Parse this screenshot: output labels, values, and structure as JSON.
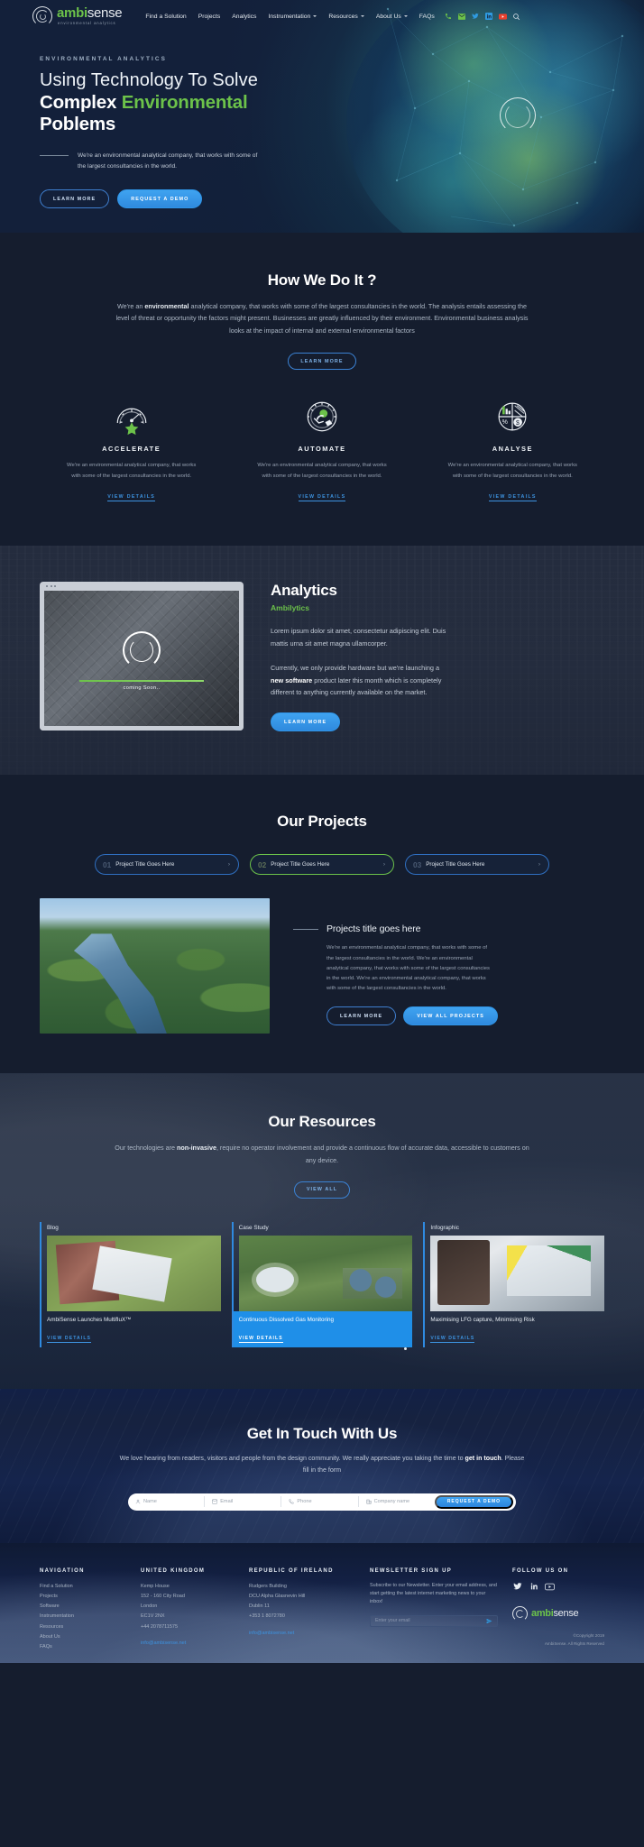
{
  "header": {
    "logo": {
      "brand_prefix": "ambi",
      "brand_suffix": "sense",
      "tagline": "environmental analytics"
    },
    "nav": [
      {
        "label": "Find a Solution",
        "has_caret": false
      },
      {
        "label": "Projects",
        "has_caret": false
      },
      {
        "label": "Analytics",
        "has_caret": false
      },
      {
        "label": "Instrumentation",
        "has_caret": true
      },
      {
        "label": "Resources",
        "has_caret": true
      },
      {
        "label": "About Us",
        "has_caret": true
      },
      {
        "label": "FAQs",
        "has_caret": false
      }
    ],
    "social": [
      "phone-icon",
      "email-icon",
      "twitter-icon",
      "linkedin-icon",
      "youtube-icon",
      "search-icon"
    ]
  },
  "hero": {
    "eyebrow": "ENVIRONMENTAL ANALYTICS",
    "title_line1": "Using Technology To Solve",
    "title_line2_white": "Complex",
    "title_line2_green": "Environmental",
    "title_line3": "Poblems",
    "description": "We're an environmental analytical company, that works with some of the largest consultancies in the world.",
    "btn_learn_more": "LEARN MORE",
    "btn_request_demo": "REQUEST A DEMO"
  },
  "how": {
    "title": "How We Do It ?",
    "intro_pre": "We're an ",
    "intro_bold": "environmental",
    "intro_post": " analytical company, that works with some of the largest consultancies in the world. The analysis entails assessing the level of threat or opportunity the factors might present. Businesses are greatly influenced by their environment. Environmental business analysis looks at the impact of internal and external environmental factors",
    "btn_learn_more": "LEARN MORE",
    "cards": [
      {
        "icon": "speedometer-star-icon",
        "title": "ACCELERATE",
        "text": "We're an environmental analytical company, that works with some of the largest consultancies in the world.",
        "link": "VIEW DETAILS"
      },
      {
        "icon": "gear-dial-icon",
        "title": "AUTOMATE",
        "text": "We're an environmental analytical company, that works with some of the largest consultancies in the world.",
        "link": "VIEW DETAILS"
      },
      {
        "icon": "pie-chart-icon",
        "title": "ANALYSE",
        "text": "We're an environmental analytical company, that works with some of the largest consultancies in the world.",
        "link": "VIEW DETAILS"
      }
    ]
  },
  "analytics": {
    "title": "Analytics",
    "subtitle": "Ambilytics",
    "paragraph1": "Lorem ipsum dolor sit amet, consectetur adipiscing elit. Duis mattis urna sit amet magna ullamcorper.",
    "p2_pre": "Currently, we only provide hardware but we're launching a ",
    "p2_bold": "new software",
    "p2_post": " product later this month which is completely different to anything currently available on the market.",
    "btn_learn_more": "LEARN MORE",
    "screen_caption": "coming Soon.."
  },
  "projects": {
    "title": "Our Projects",
    "tabs": [
      {
        "num": "01",
        "label": "Project Title Goes Here",
        "active": false
      },
      {
        "num": "02",
        "label": "Project Title Goes Here",
        "active": true
      },
      {
        "num": "03",
        "label": "Project Title Goes Here",
        "active": false
      }
    ],
    "detail_title": "Projects title goes here",
    "detail_text": "We're an environmental analytical company, that works with some of the largest consultancies in the world. We're an environmental analytical company, that works with some of the largest consultancies in the world. We're an environmental analytical company, that works with some of the largest consultancies in the world.",
    "btn_learn_more": "LEARN MORE",
    "btn_view_all": "VIEW ALL PROJECTS"
  },
  "resources": {
    "title": "Our Resources",
    "sub_pre": "Our technologies are ",
    "sub_bold": "non-invasive",
    "sub_post": ", require no operator involvement and provide a continuous flow of accurate data, accessible to customers on any device.",
    "btn_view_all": "VIEW ALL",
    "cards": [
      {
        "kicker": "Blog",
        "title": "AmbiSense Launches MultifluX™",
        "link": "VIEW DETAILS",
        "active": false
      },
      {
        "kicker": "Case Study",
        "title": "Continuous Dissolved Gas Monitoring",
        "link": "VIEW DETAILS",
        "active": true
      },
      {
        "kicker": "Infographic",
        "title": "Maximising LFG capture, Minimising Risk",
        "link": "VIEW DETAILS",
        "active": false
      }
    ]
  },
  "contact": {
    "title": "Get In Touch With Us",
    "sub_pre": "We love hearing from readers, visitors and people from the design community. We really appreciate you taking the time to ",
    "sub_bold": "get in touch",
    "sub_post": ". Please fill in the form",
    "fields": [
      {
        "icon": "user-icon",
        "placeholder": "Name"
      },
      {
        "icon": "email-icon",
        "placeholder": "Email"
      },
      {
        "icon": "phone-icon",
        "placeholder": "Phone"
      },
      {
        "icon": "building-icon",
        "placeholder": "Company name"
      }
    ],
    "submit": "REQUEST A DEMO"
  },
  "footer": {
    "columns": [
      {
        "head": "NAVIGATION",
        "links": [
          "Find a Solution",
          "Projects",
          "Software",
          "Instrumentation",
          "Resources",
          "About Us",
          "FAQs"
        ]
      },
      {
        "head": "UNITED KINGDOM",
        "lines": [
          "Kemp House",
          "152 - 160 City Road",
          "London",
          "EC1V 2NX",
          "+44 2078711575"
        ],
        "email": "info@ambisense.net"
      },
      {
        "head": "REPUBLIC OF IRELAND",
        "lines": [
          "Rudgers Building",
          "DCU Alpha Glasnevin Hill",
          "Dublin 11",
          "+353 1 8072780"
        ],
        "email": "info@ambisense.net"
      }
    ],
    "newsletter": {
      "head": "NEWSLETTER SIGN UP",
      "text": "Subscribe to our Newsletter. Enter your email address, and start getting the latest internet marketing news to your inbox!",
      "placeholder": "Enter your email"
    },
    "follow": {
      "head": "FOLLOW US ON",
      "icons": [
        "twitter-icon",
        "linkedin-icon",
        "youtube-icon"
      ]
    },
    "logo": {
      "brand_prefix": "ambi",
      "brand_suffix": "sense"
    },
    "copyright_line1": "©Copyright 2019",
    "copyright_line2": "AmbiSense. All Rights Reserved"
  }
}
